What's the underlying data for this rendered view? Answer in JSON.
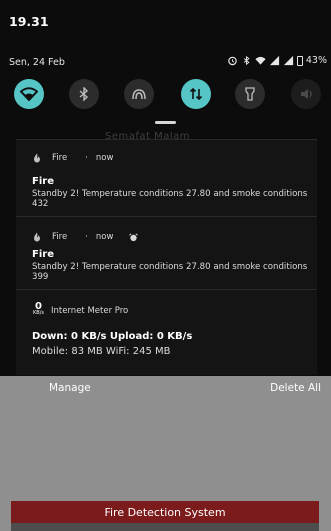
{
  "status_bar": {
    "time": "19.31",
    "date": "Sen, 24 Feb",
    "battery": "43%"
  },
  "quick_settings": [
    {
      "icon": "wifi-icon",
      "state": "on"
    },
    {
      "icon": "bluetooth-icon",
      "state": "off"
    },
    {
      "icon": "nfc-icon",
      "state": "off"
    },
    {
      "icon": "mobile-data-icon",
      "state": "on"
    },
    {
      "icon": "flashlight-icon",
      "state": "off"
    },
    {
      "icon": "sound-icon",
      "state": "dim"
    }
  ],
  "notifications": [
    {
      "app": "Fire",
      "separator": "·",
      "time": "now",
      "title": "Fire",
      "body": "Standby 2! Temperature conditions 27.80 and smoke conditions 432"
    },
    {
      "app": "Fire",
      "separator": "·",
      "time": "now",
      "title": "Fire",
      "body": "Standby 2! Temperature conditions 27.80 and smoke conditions 399"
    }
  ],
  "meter": {
    "icon_value": "0",
    "icon_unit": "KB/s",
    "app": "Internet Meter Pro",
    "line1": "Down: 0 KB/s  Upload: 0 KB/s",
    "line2": "Mobile: 83 MB   WiFi: 245 MB"
  },
  "actions": {
    "manage": "Manage",
    "delete_all": "Delete All"
  },
  "app_bar": {
    "title": "Fire Detection System"
  },
  "colors": {
    "accent": "#56c5c6",
    "app_bar": "#7c1b1b"
  }
}
